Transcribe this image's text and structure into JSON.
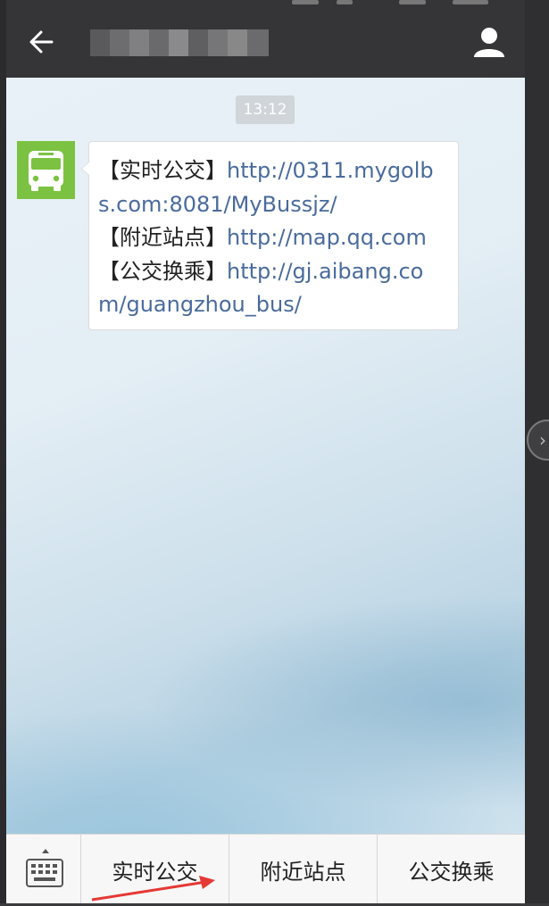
{
  "header": {
    "back_icon": "arrow-left-icon",
    "title": "",
    "profile_icon": "person-icon"
  },
  "chat": {
    "timestamp": "13:12",
    "message": {
      "avatar_icon": "bus-icon",
      "lines": [
        {
          "label": "【实时公交】",
          "link": "http://0311.mygolbs.com:8081/MyBussjz/"
        },
        {
          "label": "【附近站点】",
          "link": "http://map.qq.com"
        },
        {
          "label": "【公交换乘】",
          "link": "http://gj.aibang.com/guangzhou_bus/"
        }
      ]
    }
  },
  "menu": {
    "keyboard_icon": "keyboard-icon",
    "items": [
      "实时公交",
      "附近站点",
      "公交换乘"
    ]
  },
  "colors": {
    "header_bg": "#353538",
    "avatar_green": "#7cc242",
    "link": "#4a6b9c",
    "arrow_red": "#e53935"
  }
}
